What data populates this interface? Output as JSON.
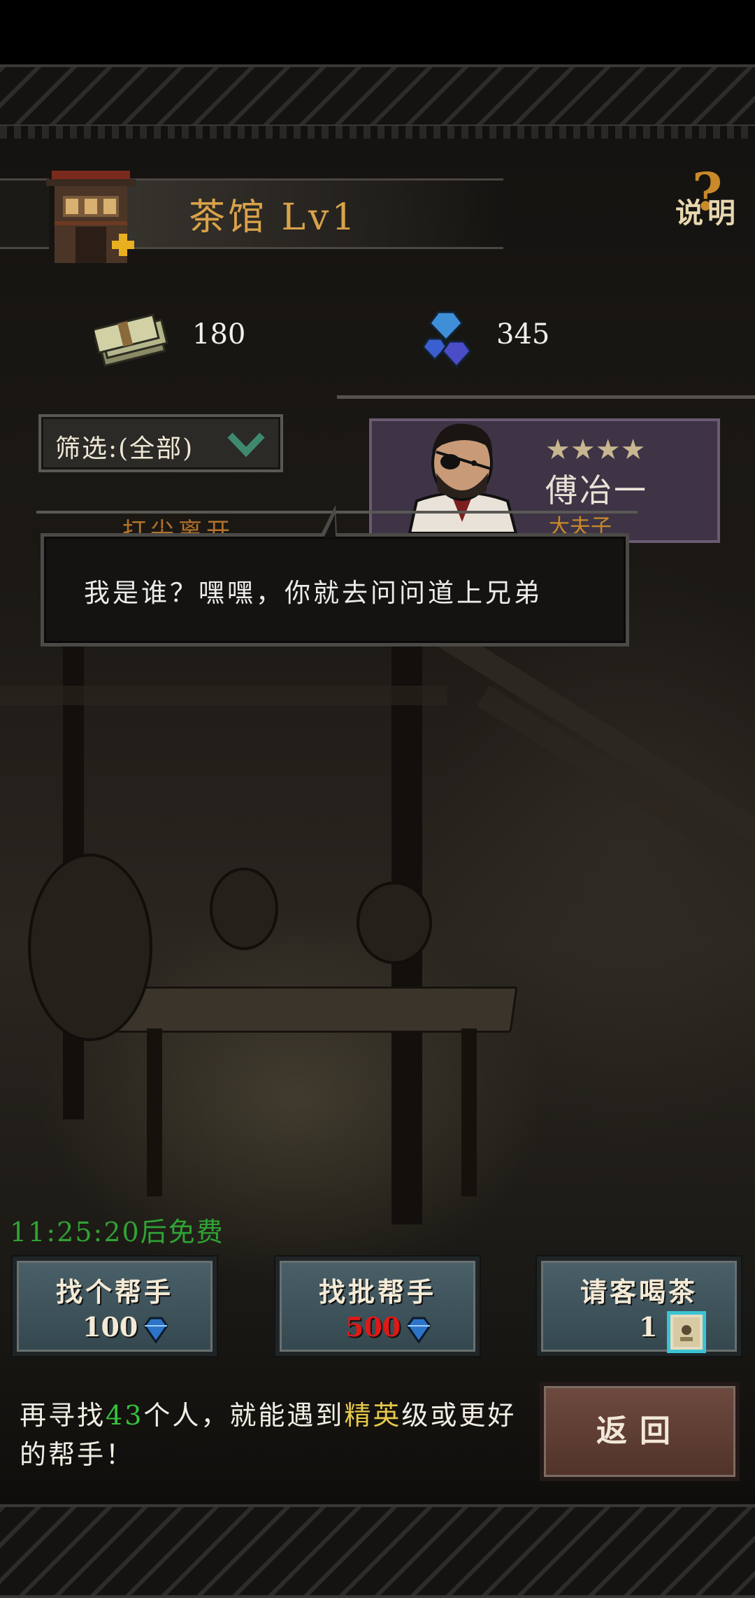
{
  "header": {
    "title": "茶馆 Lv1",
    "help_label": "说明"
  },
  "resources": {
    "money": "180",
    "gems": "345"
  },
  "filter": {
    "label": "筛选:(全部)"
  },
  "card": {
    "name": "傅冶一",
    "subtitle": "大夫子",
    "stars": 4
  },
  "peek_text": "打尖离开",
  "dialog": {
    "text": "我是谁？嘿嘿，你就去问问道上兄弟"
  },
  "timer": "11:25:20后免费",
  "buttons": [
    {
      "label": "找个帮手",
      "cost": "100",
      "cost_color": "#f3ead6",
      "icon": "gem-icon"
    },
    {
      "label": "找批帮手",
      "cost": "500",
      "cost_color": "#e01818",
      "icon": "gem-icon"
    },
    {
      "label": "请客喝茶",
      "cost": "1",
      "cost_color": "#f3ead6",
      "icon": "tea-ticket-icon"
    }
  ],
  "back_label": "返回",
  "hint": {
    "prefix": "再寻找",
    "count": "43",
    "middle": "个人，就能遇到",
    "tier": "精英",
    "suffix": "级或更好的帮手！"
  },
  "colors": {
    "title": "#d9a24a",
    "timer": "#2fa334",
    "count_highlight": "#36c23f",
    "tier_highlight": "#e7c84a",
    "card_bg": "#3e3446"
  }
}
